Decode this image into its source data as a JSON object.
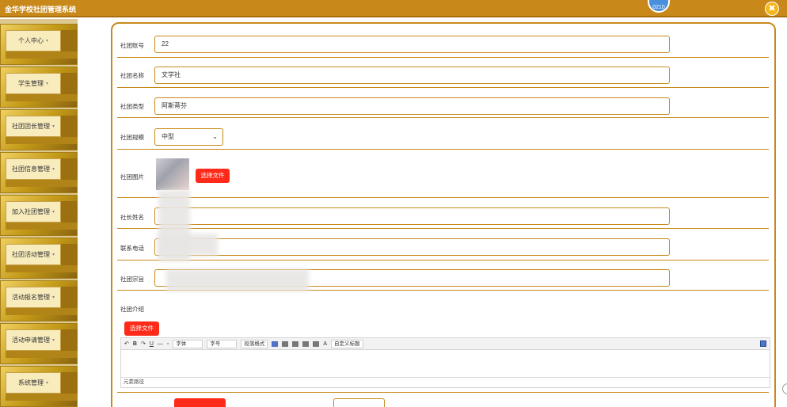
{
  "app": {
    "title": "金华学校社团管理系统",
    "avatar_text": "0210",
    "close_icon": "✖"
  },
  "sidebar": {
    "items": [
      {
        "label": "个人中心"
      },
      {
        "label": "学生管理"
      },
      {
        "label": "社团团长管理"
      },
      {
        "label": "社团信息管理"
      },
      {
        "label": "加入社团管理"
      },
      {
        "label": "社团活动管理"
      },
      {
        "label": "活动报名管理"
      },
      {
        "label": "活动申请管理"
      },
      {
        "label": "系统管理"
      }
    ]
  },
  "form": {
    "club_id": {
      "label": "社团账号",
      "value": "22"
    },
    "club_name": {
      "label": "社团名称",
      "value": "文学社"
    },
    "club_type": {
      "label": "社团类型",
      "value": "阿斯蒂芬"
    },
    "club_size": {
      "label": "社团规模",
      "value": "中型"
    },
    "club_image": {
      "label": "社团图片",
      "button": "选择文件"
    },
    "leader_name": {
      "label": "社长姓名",
      "value": ""
    },
    "phone": {
      "label": "联系电话",
      "value": ""
    },
    "purpose": {
      "label": "社团宗旨",
      "value": ""
    },
    "intro": {
      "label": "社团介绍",
      "button": "选择文件"
    }
  },
  "editor": {
    "font_label": "字体",
    "size_label": "字号",
    "paragraph_label": "段落格式",
    "custom_title_label": "自定义标题",
    "path_label": "元素路径"
  },
  "colors": {
    "accent": "#c8891a",
    "red": "#ff2a1a",
    "sidebar_bg": "#dcc890"
  }
}
